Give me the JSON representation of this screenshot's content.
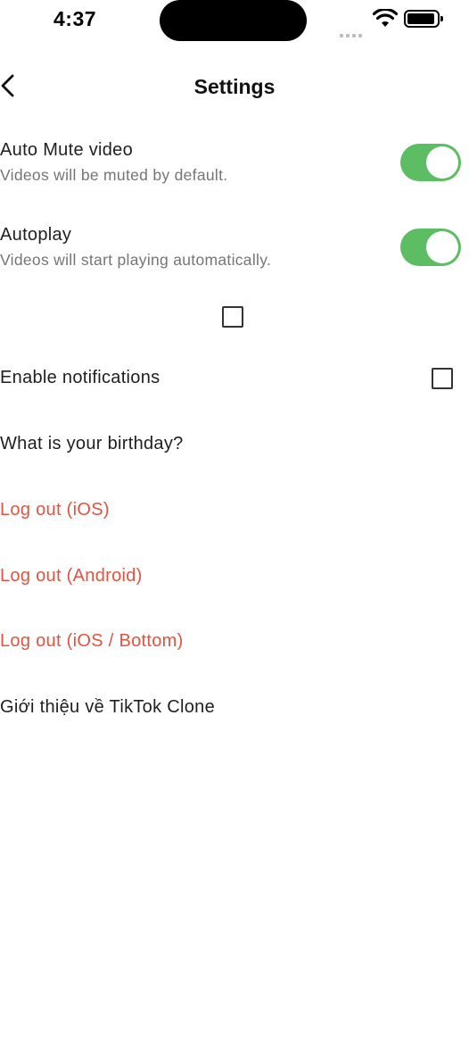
{
  "status_bar": {
    "time": "4:37"
  },
  "app_bar": {
    "title": "Settings"
  },
  "settings": {
    "auto_mute": {
      "title": "Auto Mute video",
      "subtitle": "Videos will be muted by default.",
      "enabled": true
    },
    "autoplay": {
      "title": "Autoplay",
      "subtitle": "Videos will start playing automatically.",
      "enabled": true
    },
    "standalone_checkbox": {
      "checked": false
    },
    "notifications": {
      "title": "Enable notifications",
      "checked": false
    },
    "birthday": {
      "title": "What is your birthday?"
    },
    "logout_ios": {
      "title": "Log out (iOS)"
    },
    "logout_android": {
      "title": "Log out (Android)"
    },
    "logout_ios_bottom": {
      "title": "Log out (iOS / Bottom)"
    },
    "about": {
      "title": "Giới thiệu về TikTok Clone"
    }
  },
  "colors": {
    "toggle_on": "#5cbd62",
    "danger": "#e4533f"
  },
  "icons": {
    "back": "chevron-left-icon",
    "wifi": "wifi-icon",
    "battery": "battery-icon"
  }
}
